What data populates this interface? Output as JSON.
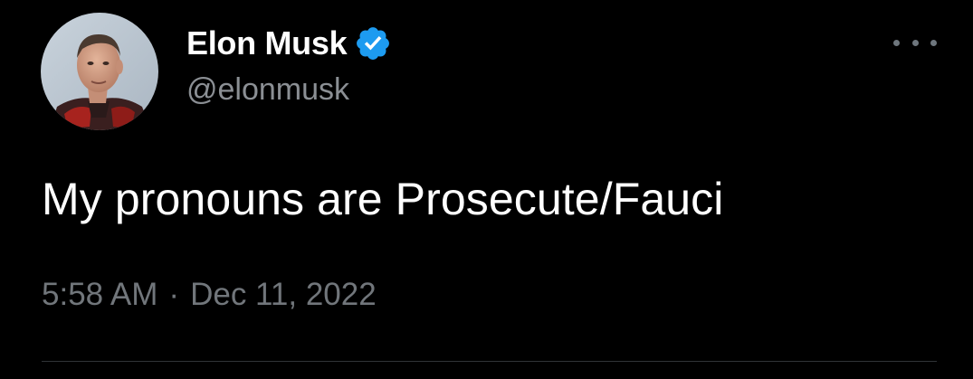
{
  "tweet": {
    "author": {
      "display_name": "Elon Musk",
      "handle": "@elonmusk",
      "verified": true,
      "avatar_icon": "profile-photo"
    },
    "text": "My pronouns are Prosecute/Fauci",
    "time": "5:58 AM",
    "separator": "·",
    "date": "Dec 11, 2022",
    "more_icon": "more-horizontal-icon"
  },
  "colors": {
    "background": "#000000",
    "primary_text": "#ffffff",
    "secondary_text": "#71767b",
    "verified_blue": "#1d9bf0",
    "divider": "#2f3336"
  }
}
